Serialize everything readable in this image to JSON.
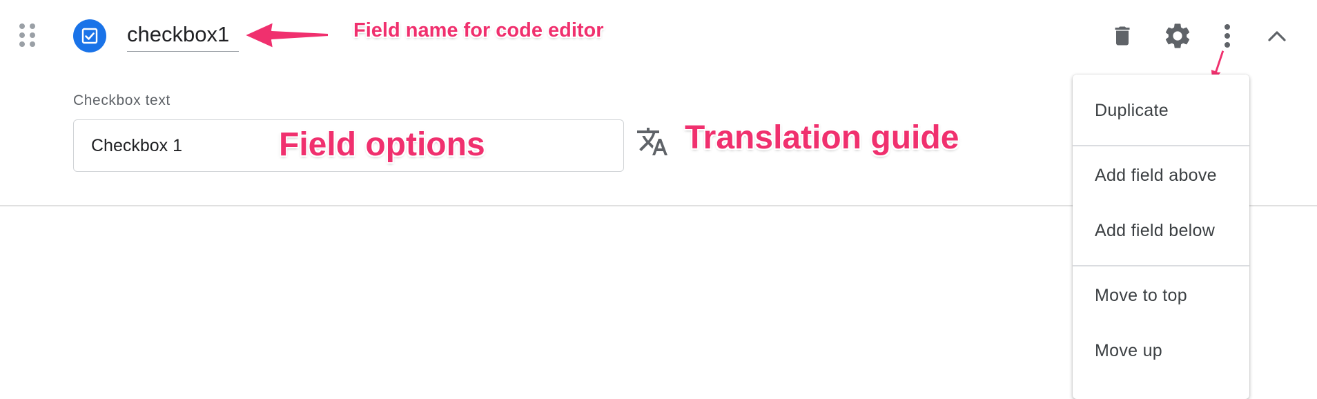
{
  "field": {
    "type_icon": "checkbox-icon",
    "name_value": "checkbox1",
    "options_label": "Checkbox text",
    "checkbox_text_value": "Checkbox 1"
  },
  "toolbar": {
    "icons": [
      "drag-handle-icon",
      "delete-icon",
      "gear-icon",
      "more-vert-icon",
      "chevron-up-icon"
    ]
  },
  "translate_icon": "translate-icon",
  "menu": {
    "items": [
      {
        "label": "Duplicate"
      },
      {
        "label": "Add field above"
      },
      {
        "label": "Add field below"
      },
      {
        "label": "Move to top"
      },
      {
        "label": "Move up"
      }
    ]
  },
  "annotations": {
    "field_name": "Field name for code editor",
    "field_options": "Field options",
    "translation_guide": "Translation guide"
  },
  "colors": {
    "accent": "#1a73e8",
    "annotation": "#f0306e",
    "icon_gray": "#5f6368"
  }
}
